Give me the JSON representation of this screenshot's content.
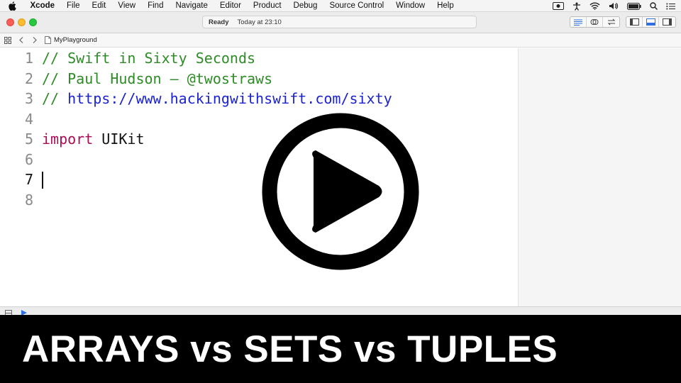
{
  "menubar": {
    "app_name": "Xcode",
    "items": [
      "File",
      "Edit",
      "View",
      "Find",
      "Navigate",
      "Editor",
      "Product",
      "Debug",
      "Source Control",
      "Window",
      "Help"
    ]
  },
  "toolbar": {
    "status": "Ready",
    "timestamp": "Today at 23:10"
  },
  "jumpbar": {
    "file_name": "MyPlayground"
  },
  "editor": {
    "lines": [
      {
        "number": "1",
        "segments": [
          {
            "type": "comment",
            "text": "// Swift in Sixty Seconds"
          }
        ]
      },
      {
        "number": "2",
        "segments": [
          {
            "type": "comment",
            "text": "// Paul Hudson — @twostraws"
          }
        ]
      },
      {
        "number": "3",
        "segments": [
          {
            "type": "comment",
            "text": "// "
          },
          {
            "type": "url",
            "text": "https://www.hackingwithswift.com/sixty"
          }
        ]
      },
      {
        "number": "4",
        "segments": []
      },
      {
        "number": "5",
        "segments": [
          {
            "type": "keyword",
            "text": "import"
          },
          {
            "type": "plain",
            "text": " UIKit"
          }
        ]
      },
      {
        "number": "6",
        "segments": []
      },
      {
        "number": "7",
        "segments": []
      },
      {
        "number": "8",
        "segments": []
      }
    ],
    "current_line": "7"
  },
  "banner": {
    "title": "ARRAYS vs SETS vs TUPLES"
  },
  "colors": {
    "comment": "#2e8b27",
    "url": "#1c23cf",
    "keyword": "#aa0d55",
    "banner_background": "#000000",
    "banner_text": "#ffffff"
  }
}
